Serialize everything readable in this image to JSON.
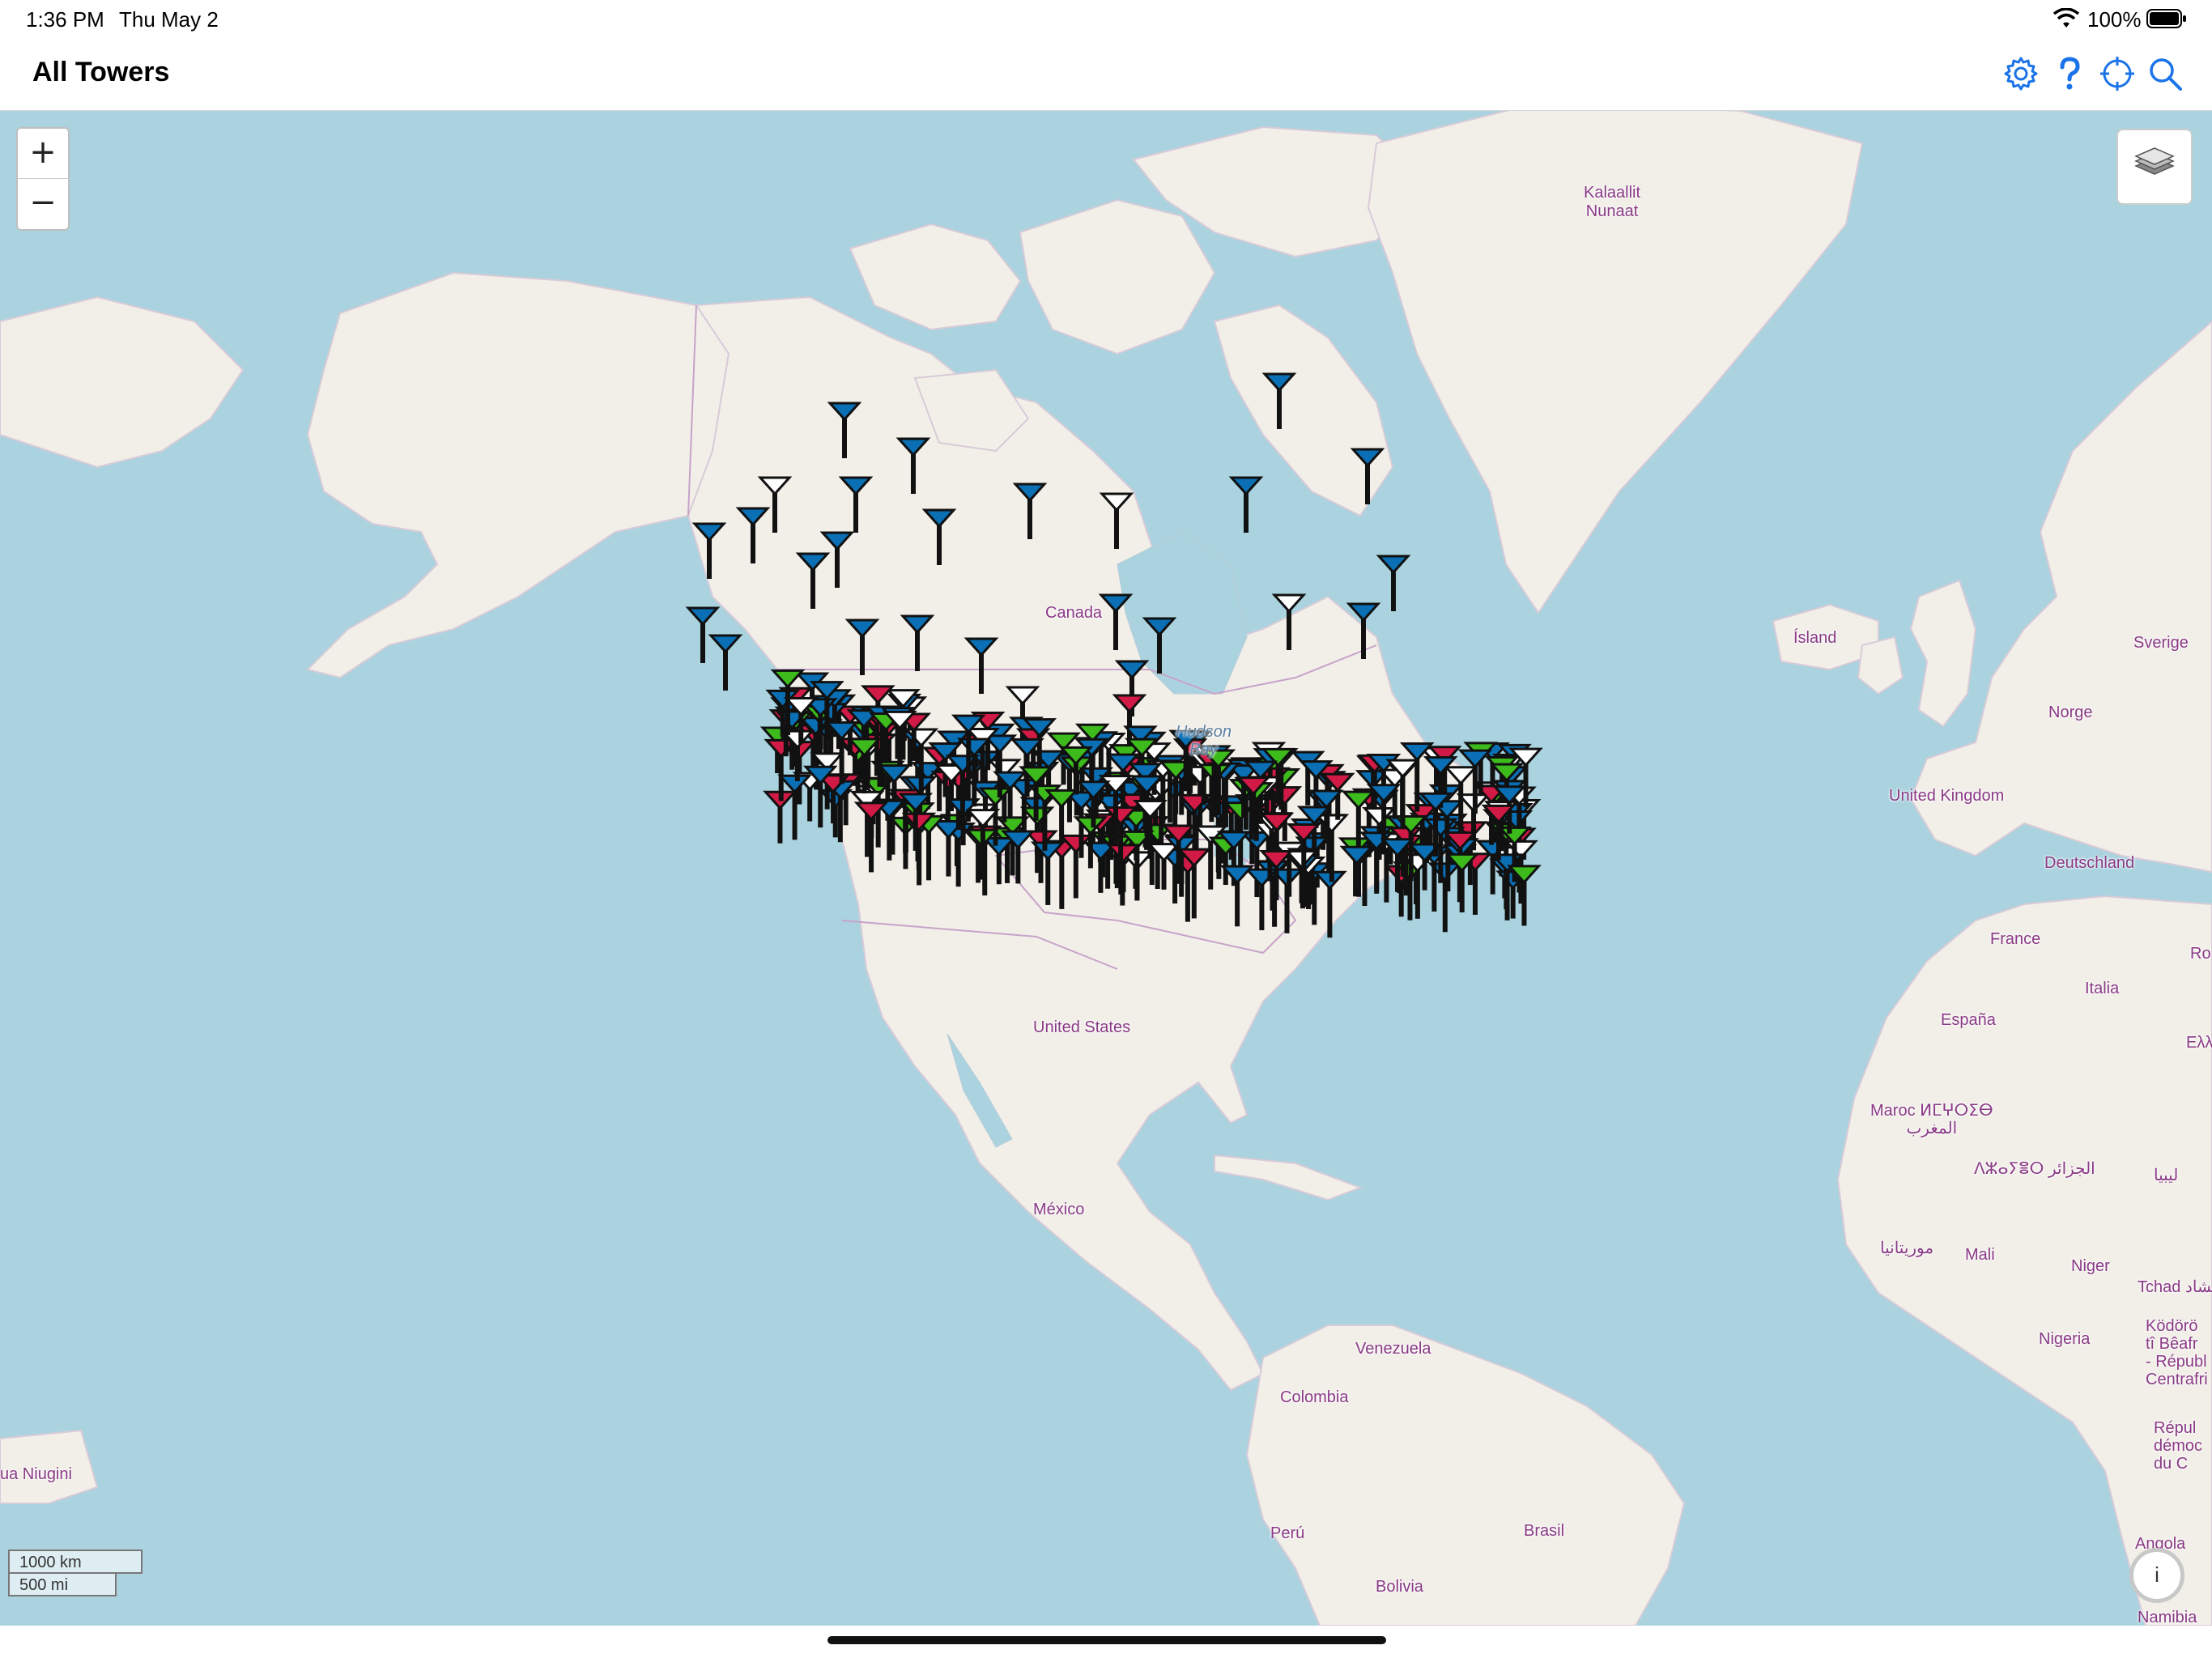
{
  "status_bar": {
    "time": "1:36 PM",
    "date": "Thu May 2",
    "battery_percent": "100%",
    "wifi_icon": "wifi-icon",
    "battery_icon": "battery-full-icon"
  },
  "nav_bar": {
    "title": "All Towers",
    "buttons": [
      "settings-icon",
      "help-icon",
      "locate-icon",
      "search-icon"
    ],
    "accent_color": "#1a73e8"
  },
  "map": {
    "zoom_in": "+",
    "zoom_out": "−",
    "layers_icon": "layers-icon",
    "labels": {
      "kalaallit": "Kalaallit\nNunaat",
      "canada": "Canada",
      "hudson_bay": "Hudson\nBay",
      "island": "Ísland",
      "sverige": "Sverige",
      "norge": "Norge",
      "united_kingdom": "United Kingdom",
      "deutschland": "Deutschland",
      "france": "France",
      "italia": "Italia",
      "espana": "España",
      "united_states": "United States",
      "mexico": "México",
      "maroc": "Maroc ⵍⵎⵖⵔⵉⴱ\nالمغرب",
      "algerie": "ⴷⵣⴰⵢⴻⵔ الجزائر",
      "libya": "ليبيا",
      "mauritania": "موريتانيا",
      "mali": "Mali",
      "niger": "Niger",
      "tchad": "Tchad تشاد",
      "nigeria": "Nigeria",
      "centrafrique": "Ködörö\ntî Bêafr\n- Républ\nCentrafri",
      "rdc": "Répul\ndémoc\ndu C",
      "venezuela": "Venezuela",
      "colombia": "Colombia",
      "peru": "Perú",
      "brasil": "Brasil",
      "bolivia": "Bolivia",
      "papua": "ua Niugini",
      "angola": "Angola",
      "namibia": "Namibia",
      "ro": "Ro",
      "ellas": "Ελλ"
    },
    "tower_colors": {
      "blue": "#0a6fb4",
      "green": "#3dbb1c",
      "red": "#d11a45",
      "white": "#ffffff"
    },
    "scale": {
      "km": "1000 km",
      "mi": "500 mi"
    },
    "info_label": "i"
  }
}
